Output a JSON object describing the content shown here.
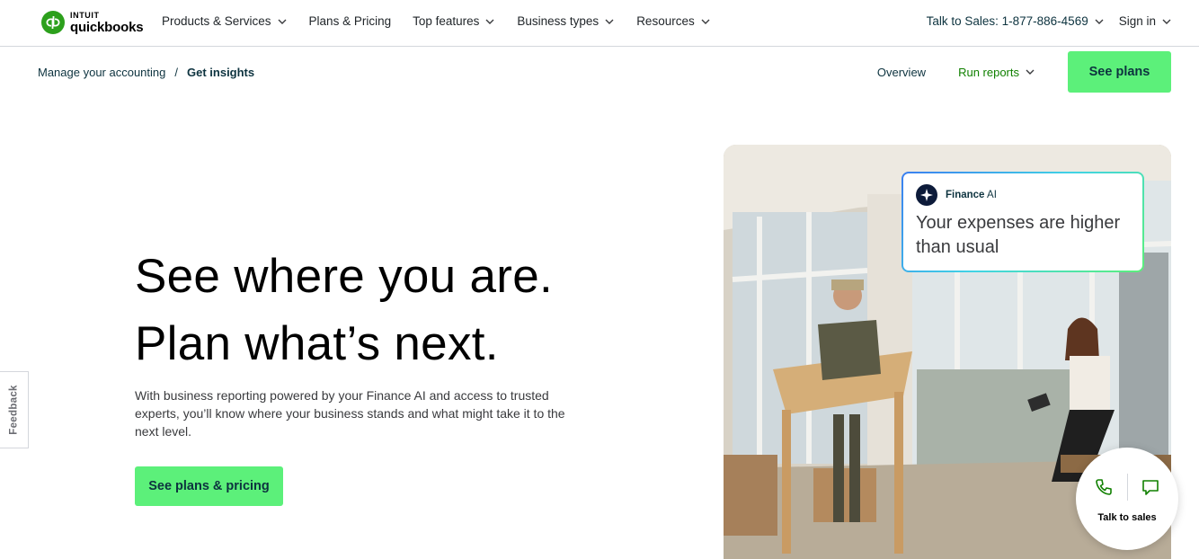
{
  "brand": {
    "top": "INTUIT",
    "name": "quickbooks",
    "color": "#2CA01C"
  },
  "nav": {
    "items": [
      {
        "label": "Products & Services"
      },
      {
        "label": "Plans & Pricing"
      },
      {
        "label": "Top features"
      },
      {
        "label": "Business types"
      },
      {
        "label": "Resources"
      }
    ],
    "sales": "Talk to Sales: 1-877-886-4569",
    "signin": "Sign in"
  },
  "subnav": {
    "breadcrumb": {
      "parent": "Manage your accounting",
      "separator": "/",
      "current": "Get insights"
    },
    "overview": "Overview",
    "run_reports": "Run reports",
    "see_plans": "See plans"
  },
  "hero": {
    "title_line1": "See where you are.",
    "title_line2": "Plan what’s next.",
    "body": "With business reporting powered by your Finance AI and access to trusted experts, you’ll know where your business stands and what might take it to the next level.",
    "cta": "See plans & pricing"
  },
  "feedback": {
    "label": "Feedback"
  },
  "finance_card": {
    "brand": "Finance",
    "brand_suffix": "AI",
    "message": "Your expenses are higher than usual",
    "icon": "sparkle-icon"
  },
  "sales_bubble": {
    "label": "Talk to sales",
    "icons": [
      "phone-icon",
      "chat-icon"
    ]
  },
  "colors": {
    "accent_green": "#5CF07A",
    "text_dark": "#0D333F",
    "link_green": "#108000"
  }
}
